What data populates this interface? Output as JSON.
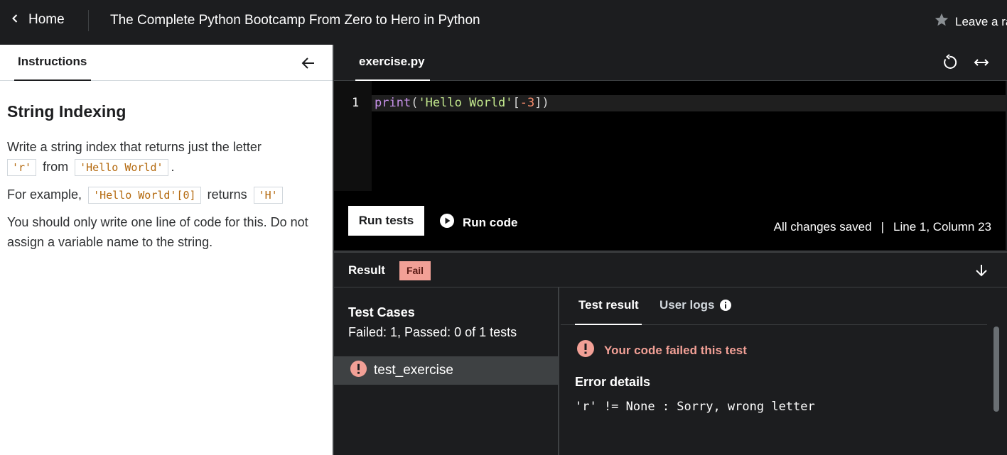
{
  "header": {
    "home_label": "Home",
    "course_title": "The Complete Python Bootcamp From Zero to Hero in Python",
    "rating_label": "Leave a rating"
  },
  "instructions_panel": {
    "tab_label": "Instructions",
    "title": "String Indexing",
    "p1_text_a": "Write a string index that returns just the letter",
    "p1_code_a": "'r'",
    "p1_text_b": "from",
    "p1_code_b": "'Hello World'",
    "p1_text_c": ".",
    "p2_text_a": "For example,",
    "p2_code_a": "'Hello World'[0]",
    "p2_text_b": "returns",
    "p2_code_b": "'H'",
    "p3_text": "You should only write one line of code for this. Do not assign a variable name to the string."
  },
  "editor": {
    "file_tab": "exercise.py",
    "line_number": "1",
    "code_tokens": {
      "fn": "print",
      "open": "(",
      "str": "'Hello World'",
      "lbracket": "[",
      "num": "-3",
      "rbracket": "])"
    },
    "run_tests_label": "Run tests",
    "run_code_label": "Run code",
    "saved_status": "All changes saved",
    "separator": "|",
    "cursor_position": "Line 1, Column 23"
  },
  "result": {
    "label": "Result",
    "badge": "Fail",
    "test_cases_title": "Test Cases",
    "test_cases_summary": "Failed: 1, Passed: 0 of 1 tests",
    "cases": [
      {
        "name": "test_exercise"
      }
    ],
    "tab_test_result": "Test result",
    "tab_user_logs": "User logs",
    "fail_message": "Your code failed this test",
    "error_details_title": "Error details",
    "error_details_text": "'r' != None : Sorry, wrong letter"
  },
  "colors": {
    "header_bg": "#1c1d1f",
    "code_bg": "#000000",
    "fail_badge": "#f2a096",
    "inline_code": "#b4690e"
  }
}
